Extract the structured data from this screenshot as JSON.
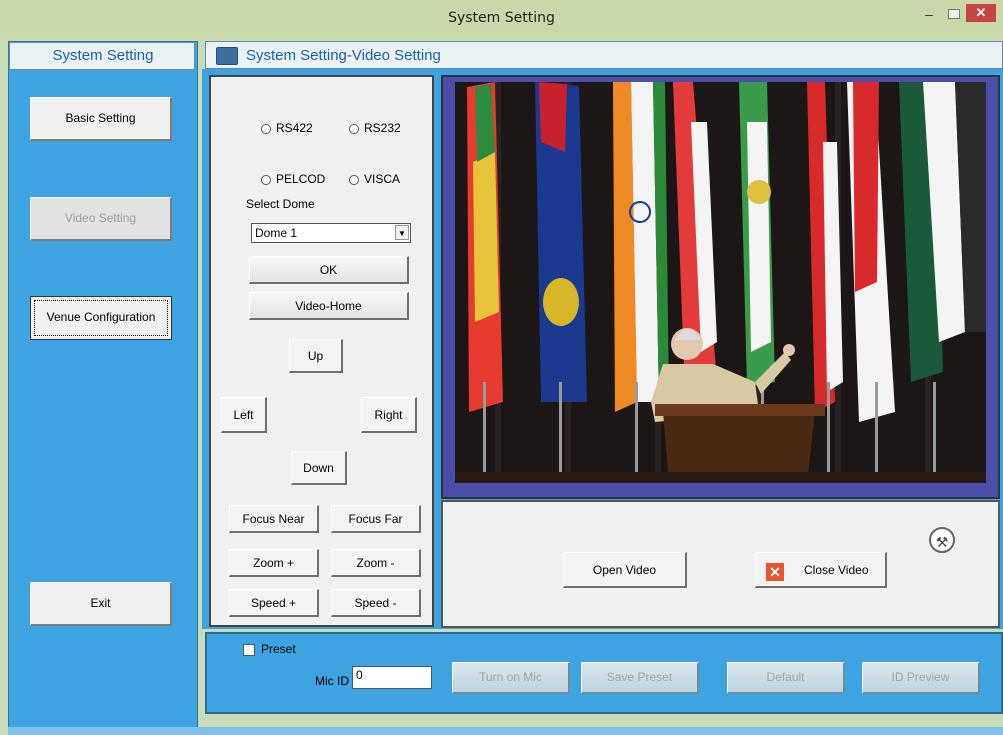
{
  "window": {
    "title": "System Setting"
  },
  "sidebar": {
    "title": "System Setting",
    "items": [
      {
        "label": "Basic Setting",
        "state": "enabled"
      },
      {
        "label": "Video Setting",
        "state": "disabled"
      },
      {
        "label": "Venue Configuration",
        "state": "focused"
      },
      {
        "label": "Exit",
        "state": "enabled"
      }
    ]
  },
  "header": {
    "title": "System Setting-Video Setting"
  },
  "control": {
    "protocol_options": [
      "RS422",
      "RS232"
    ],
    "camera_options": [
      "PELCOD",
      "VISCA"
    ],
    "select_dome_label": "Select Dome",
    "select_dome_value": "Dome 1",
    "ok_label": "OK",
    "video_home_label": "Video-Home",
    "up_label": "Up",
    "left_label": "Left",
    "right_label": "Right",
    "down_label": "Down",
    "focus_near_label": "Focus Near",
    "focus_far_label": "Focus Far",
    "zoom_in_label": "Zoom +",
    "zoom_out_label": "Zoom -",
    "speed_up_label": "Speed +",
    "speed_down_label": "Speed -"
  },
  "video": {
    "open_label": "Open Video",
    "close_label": "Close Video"
  },
  "bottom": {
    "preset_label": "Preset",
    "mic_id_label": "Mic ID",
    "mic_id_value": "0",
    "turn_on_mic_label": "Turn on Mic",
    "save_preset_label": "Save Preset",
    "default_label": "Default",
    "id_preview_label": "ID Preview"
  },
  "colors": {
    "panel_blue": "#3ea4e1",
    "title_bar": "#c9d8a9",
    "close_button": "#c7453f"
  }
}
